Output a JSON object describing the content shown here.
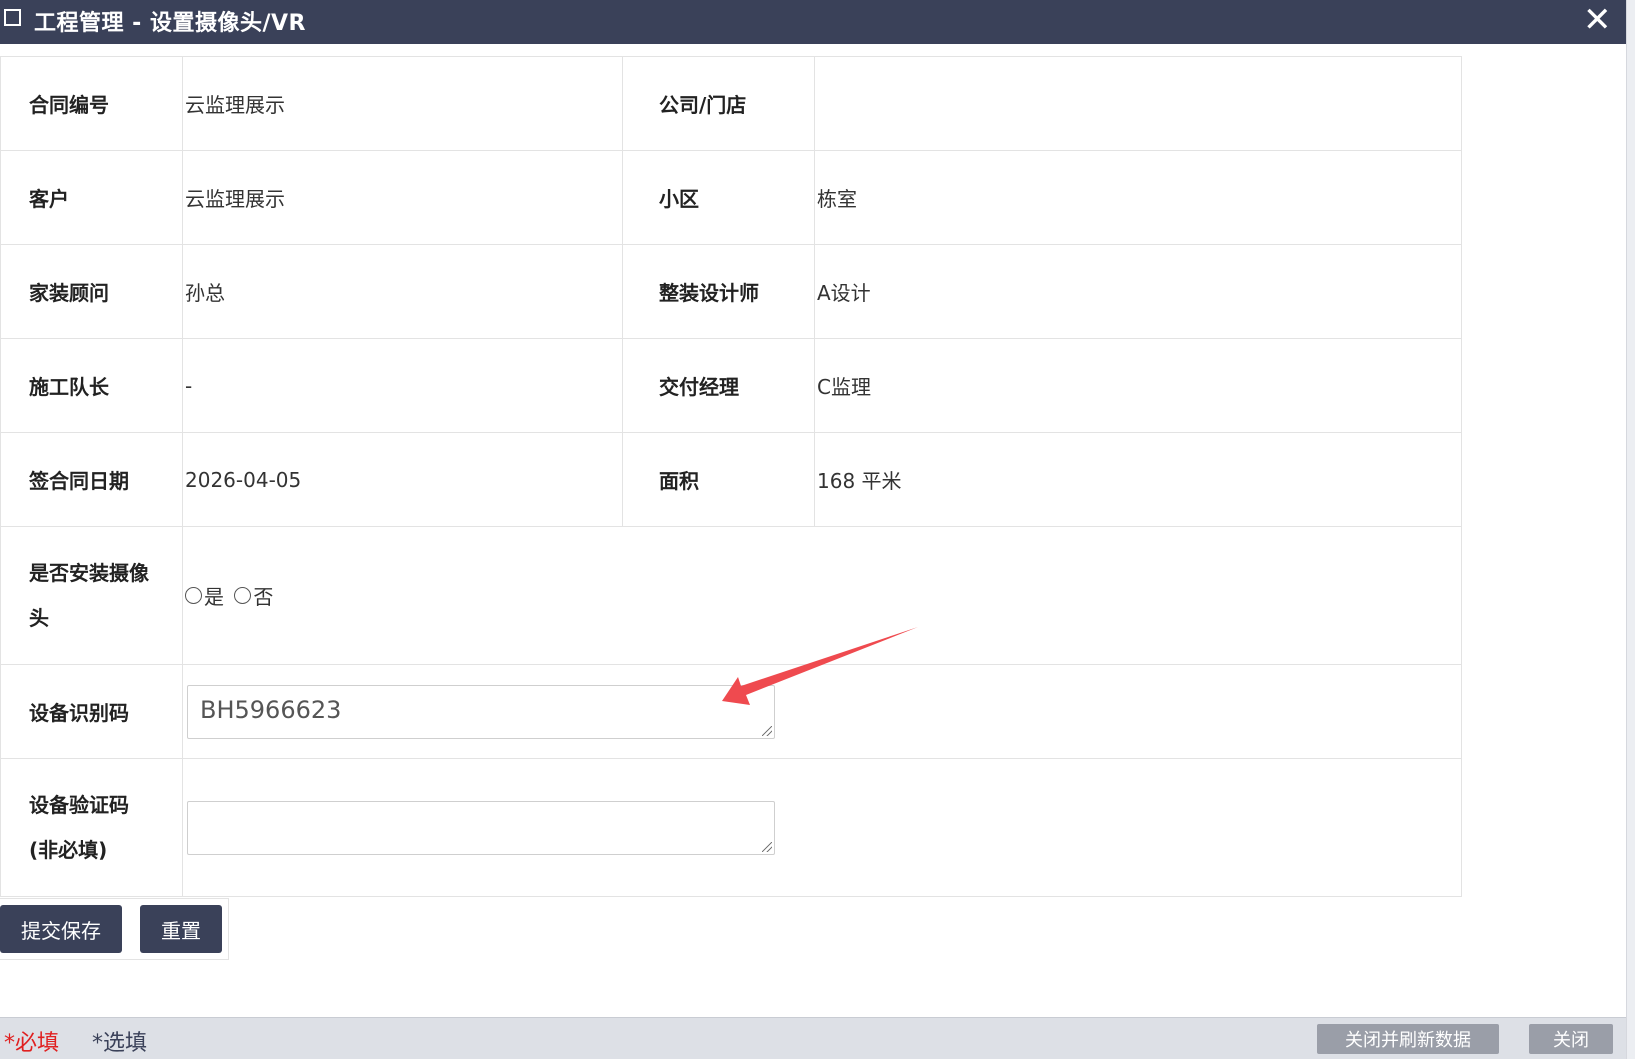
{
  "window": {
    "title": "工程管理 - 设置摄像头/VR"
  },
  "form": {
    "contract_no_label": "合同编号",
    "contract_no_value": "云监理展示",
    "company_label": "公司/门店",
    "company_value": "",
    "customer_label": "客户",
    "customer_value": "云监理展示",
    "community_label": "小区",
    "community_value": "栋室",
    "consultant_label": "家装顾问",
    "consultant_value": "孙总",
    "designer_label": "整装设计师",
    "designer_value": "A设计",
    "foreman_label": "施工队长",
    "foreman_value": "-",
    "delivery_manager_label": "交付经理",
    "delivery_manager_value": "C监理",
    "sign_date_label": "签合同日期",
    "sign_date_value": "2026-04-05",
    "area_label": "面积",
    "area_value": "168 平米",
    "camera_label_line1": "是否安装摄像",
    "camera_label_line2": "头",
    "camera_yes": "是",
    "camera_no": "否",
    "device_id_label": "设备识别码",
    "device_id_value": "BH5966623",
    "verify_code_label_line1": "设备验证码",
    "verify_code_label_line2": "(非必填)",
    "verify_code_value": ""
  },
  "buttons": {
    "submit": "提交保存",
    "reset": "重置"
  },
  "footer": {
    "required_legend": "*必填",
    "optional_legend": "*选填",
    "close_refresh": "关闭并刷新数据",
    "close": "关闭"
  },
  "colors": {
    "header_bg": "#3a4159",
    "required": "#e02020",
    "annotation_arrow": "#ef4a4f"
  }
}
